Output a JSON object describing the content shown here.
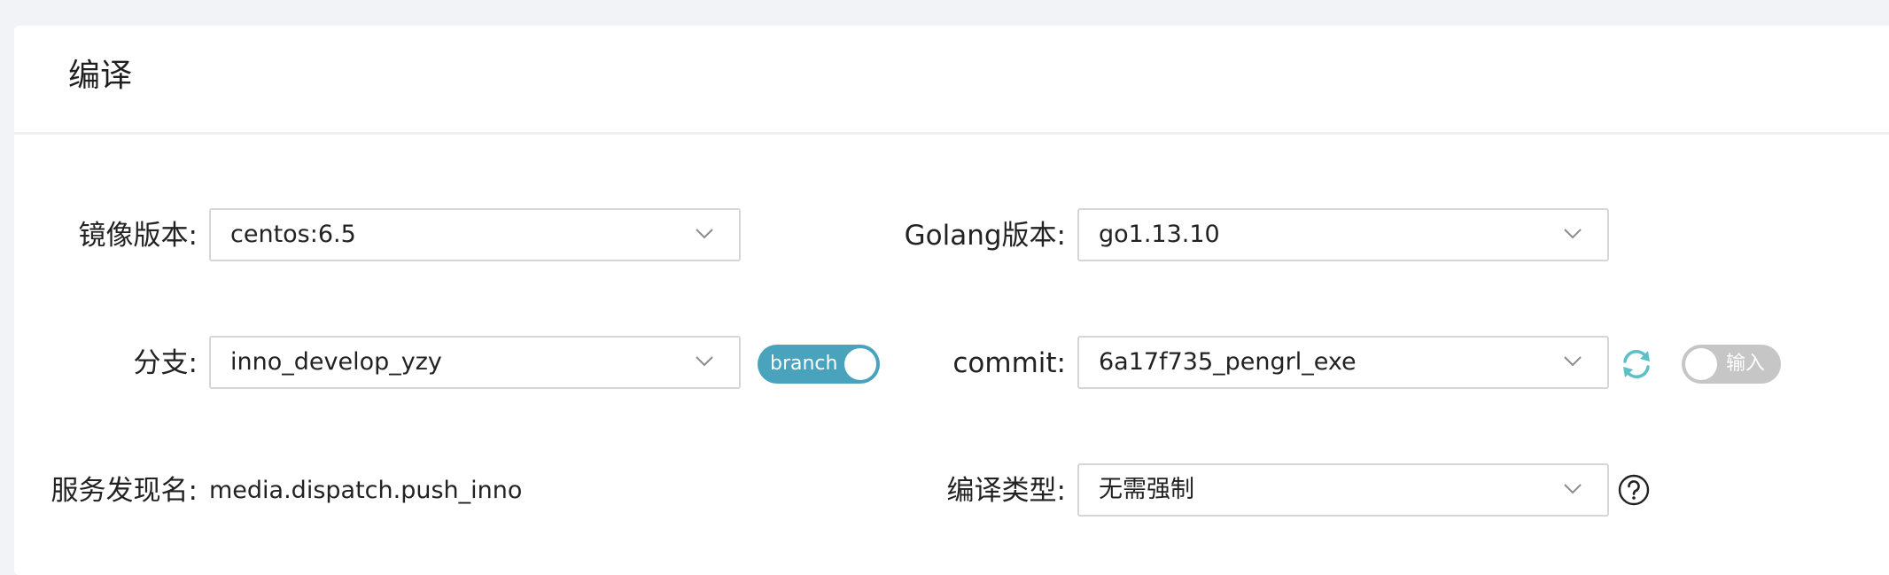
{
  "section": {
    "title": "编译"
  },
  "fields": {
    "image_version": {
      "label": "镜像版本:",
      "value": "centos:6.5"
    },
    "golang_version": {
      "label": "Golang版本:",
      "value": "go1.13.10"
    },
    "branch": {
      "label": "分支:",
      "value": "inno_develop_yzy",
      "toggle_label": "branch",
      "toggle_on": true
    },
    "commit": {
      "label": "commit:",
      "value": "6a17f735_pengrl_exe",
      "toggle_label": "输入",
      "toggle_on": false
    },
    "service_discovery": {
      "label": "服务发现名:",
      "value": "media.dispatch.push_inno"
    },
    "build_type": {
      "label": "编译类型:",
      "value": "无需强制"
    }
  },
  "icons": {
    "chevron": "chevron-down-icon",
    "refresh": "refresh-icon",
    "help": "question-circle-icon"
  },
  "colors": {
    "toggle_on": "#4aa3bd",
    "toggle_off": "#c6c6c6",
    "refresh_icon": "#5bc0c7",
    "border": "#d4d6da",
    "background": "#f2f3f7"
  }
}
